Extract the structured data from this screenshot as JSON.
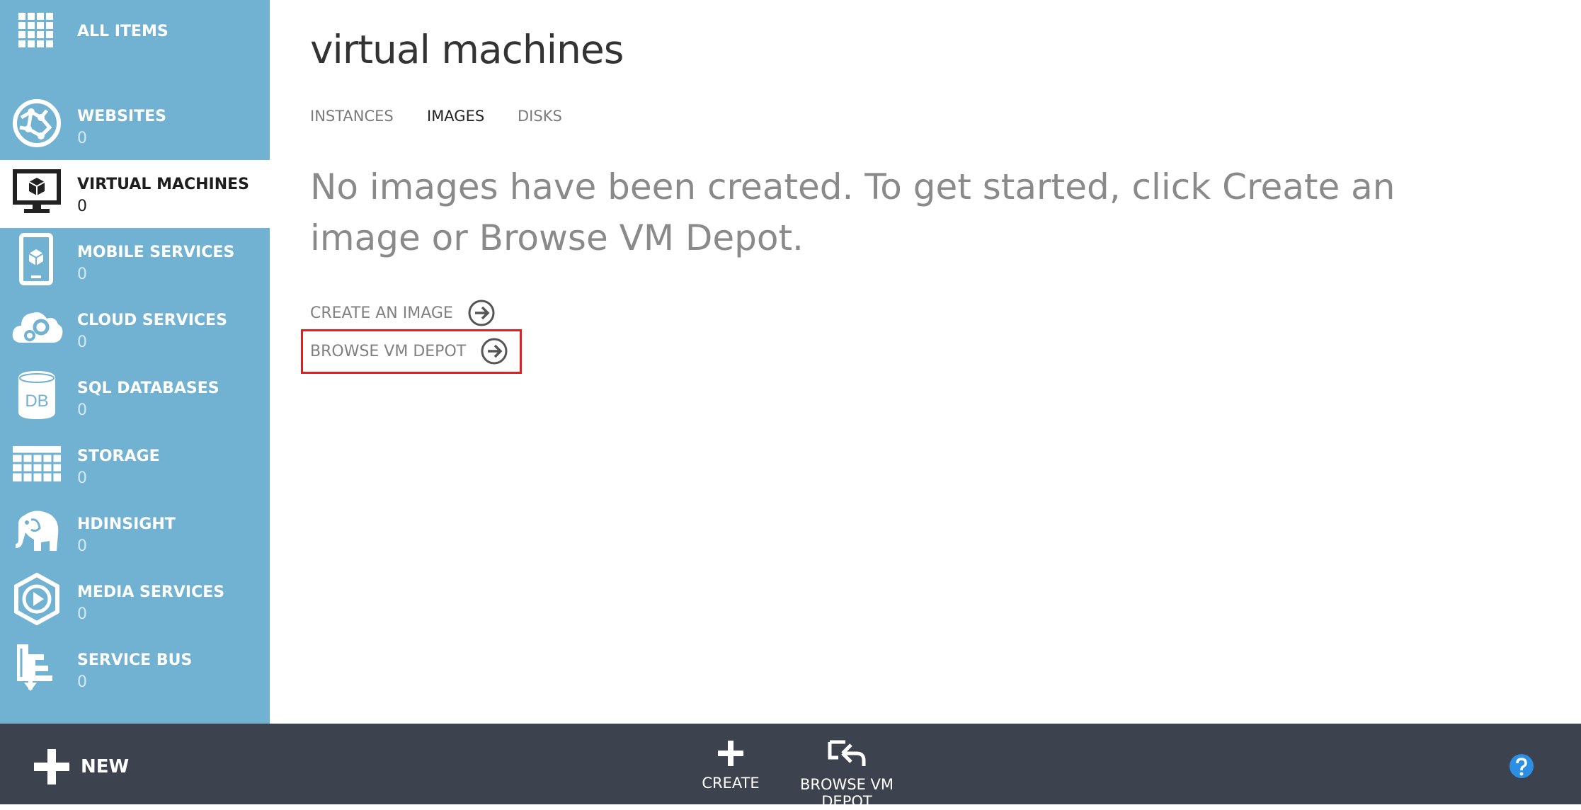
{
  "sidebar": {
    "items": [
      {
        "name": "all-items",
        "icon": "grid-icon",
        "label": "ALL ITEMS",
        "count": ""
      },
      {
        "name": "websites",
        "icon": "globe-icon",
        "label": "WEBSITES",
        "count": "0"
      },
      {
        "name": "virtual-machines",
        "icon": "monitor-icon",
        "label": "VIRTUAL MACHINES",
        "count": "0",
        "active": true
      },
      {
        "name": "mobile-services",
        "icon": "phone-icon",
        "label": "MOBILE SERVICES",
        "count": "0"
      },
      {
        "name": "cloud-services",
        "icon": "cloud-gear-icon",
        "label": "CLOUD SERVICES",
        "count": "0"
      },
      {
        "name": "sql-databases",
        "icon": "database-icon",
        "label": "SQL DATABASES",
        "count": "0"
      },
      {
        "name": "storage",
        "icon": "table-icon",
        "label": "STORAGE",
        "count": "0"
      },
      {
        "name": "hdinsight",
        "icon": "elephant-icon",
        "label": "HDINSIGHT",
        "count": "0"
      },
      {
        "name": "media-services",
        "icon": "play-icon",
        "label": "MEDIA SERVICES",
        "count": "0"
      },
      {
        "name": "service-bus",
        "icon": "service-bus-icon",
        "label": "SERVICE BUS",
        "count": "0"
      }
    ],
    "db_icon_text": "DB"
  },
  "main": {
    "title": "virtual machines",
    "tabs": [
      {
        "label": "INSTANCES",
        "active": false
      },
      {
        "label": "IMAGES",
        "active": true
      },
      {
        "label": "DISKS",
        "active": false
      }
    ],
    "empty_message": "No images have been created. To get started, click Create an image or Browse VM Depot.",
    "links": {
      "create_image": "CREATE AN IMAGE",
      "browse_depot": "BROWSE VM DEPOT"
    }
  },
  "bottom_bar": {
    "new_label": "NEW",
    "commands": [
      {
        "label": "CREATE",
        "icon": "plus-icon"
      },
      {
        "label": "BROWSE VM DEPOT",
        "icon": "browse-depot-icon"
      }
    ],
    "help_icon": "help-icon"
  },
  "colors": {
    "sidebar": "#71b1d1",
    "bottom_bar": "#3d434e",
    "highlight": "#e02020",
    "help": "#2d8fe3"
  }
}
